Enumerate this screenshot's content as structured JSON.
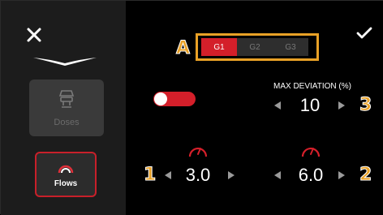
{
  "sidebar": {
    "close_icon": "close-icon",
    "logo_icon": "wings-logo",
    "doses": {
      "label": "Doses",
      "icon": "grinder-icon"
    },
    "flows": {
      "label": "Flows",
      "icon": "flow-gauge-icon"
    }
  },
  "grinders": {
    "items": [
      {
        "label": "G1",
        "selected": true
      },
      {
        "label": "G2",
        "selected": false
      },
      {
        "label": "G3",
        "selected": false
      }
    ]
  },
  "annotations": {
    "a": "A",
    "one": "1",
    "two": "2",
    "three": "3"
  },
  "confirm_icon": "checkmark-icon",
  "toggle": {
    "on": true
  },
  "max_deviation": {
    "label": "MAX DEVIATION (%)",
    "value": "10"
  },
  "flow_1": {
    "value": "3.0",
    "icon": "gauge-icon"
  },
  "flow_2": {
    "value": "6.0",
    "icon": "gauge-icon"
  },
  "colors": {
    "accent": "#d41f2a",
    "annotation": "#e9a126",
    "sidebar_bg": "#1c1c1c",
    "background": "#000000"
  }
}
